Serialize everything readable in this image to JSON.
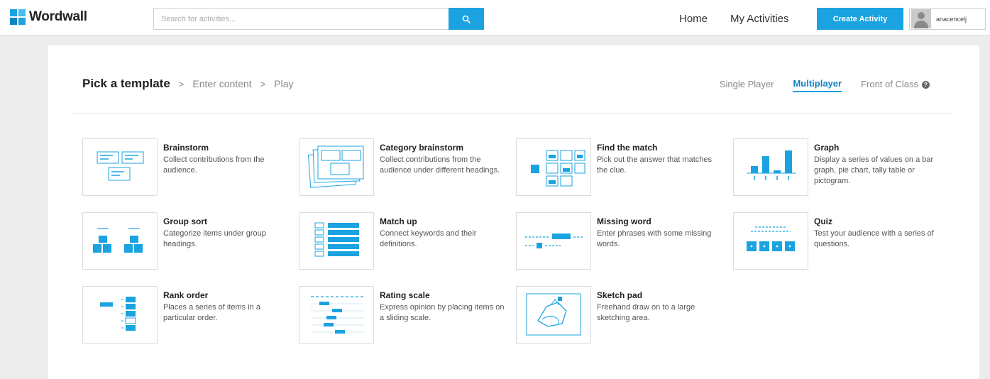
{
  "app": {
    "logo_text": "Wordwall"
  },
  "search": {
    "placeholder": "Search for activities..."
  },
  "nav": {
    "home": "Home",
    "my_activities": "My Activities",
    "create": "Create Activity",
    "username": "anacencelj"
  },
  "breadcrumb": {
    "current": "Pick a template",
    "sep": ">",
    "step2": "Enter content",
    "step3": "Play"
  },
  "modes": {
    "single": "Single Player",
    "multi": "Multiplayer",
    "front": "Front of Class",
    "active": "Multiplayer"
  },
  "colors": {
    "accent": "#1aa3e0",
    "active_text": "#1681c4"
  },
  "icons": {
    "search": "search-icon",
    "help": "help-icon",
    "avatar": "avatar"
  },
  "templates": [
    {
      "title": "Brainstorm",
      "desc": "Collect contributions from the audience."
    },
    {
      "title": "Category brainstorm",
      "desc": "Collect contributions from the audience under different headings."
    },
    {
      "title": "Find the match",
      "desc": "Pick out the answer that matches the clue."
    },
    {
      "title": "Graph",
      "desc": "Display a series of values on a bar graph, pie chart, tally table or pictogram."
    },
    {
      "title": "Group sort",
      "desc": "Categorize items under group headings."
    },
    {
      "title": "Match up",
      "desc": "Connect keywords and their definitions."
    },
    {
      "title": "Missing word",
      "desc": "Enter phrases with some missing words."
    },
    {
      "title": "Quiz",
      "desc": "Test your audience with a series of questions."
    },
    {
      "title": "Rank order",
      "desc": "Places a series of items in a particular order."
    },
    {
      "title": "Rating scale",
      "desc": "Express opinion by placing items on a sliding scale."
    },
    {
      "title": "Sketch pad",
      "desc": "Freehand draw on to a large sketching area."
    }
  ]
}
